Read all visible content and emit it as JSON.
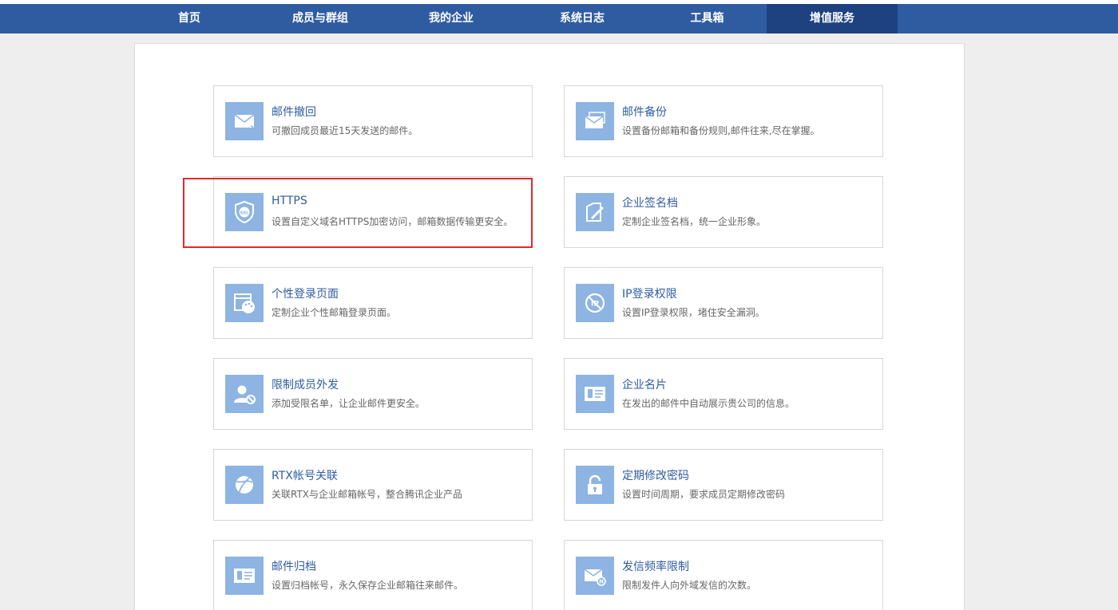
{
  "nav": {
    "items": [
      {
        "label": "首页",
        "width": 164
      },
      {
        "label": "成员与群组",
        "width": 164
      },
      {
        "label": "我的企业",
        "width": 164
      },
      {
        "label": "系统日志",
        "width": 164
      },
      {
        "label": "工具箱",
        "width": 149
      },
      {
        "label": "增值服务",
        "width": 164
      }
    ],
    "active": "增值服务"
  },
  "services": [
    {
      "title": "邮件撤回",
      "desc": "可撤回成员最近15天发送的邮件。",
      "icon": "mail-recall-icon"
    },
    {
      "title": "邮件备份",
      "desc": "设置备份邮箱和备份规则,邮件往来,尽在掌握。",
      "icon": "mail-backup-icon"
    },
    {
      "title": "HTTPS",
      "desc": "设置自定义域名HTTPS加密访问，邮箱数据传输更安全。",
      "icon": "ssl-shield-icon"
    },
    {
      "title": "企业签名档",
      "desc": "定制企业签名档，统一企业形象。",
      "icon": "signature-pen-icon"
    },
    {
      "title": "个性登录页面",
      "desc": "定制企业个性邮箱登录页面。",
      "icon": "palette-window-icon"
    },
    {
      "title": "IP登录权限",
      "desc": "设置IP登录权限，堵住安全漏洞。",
      "icon": "ip-block-icon"
    },
    {
      "title": "限制成员外发",
      "desc": "添加受限名单，让企业邮件更安全。",
      "icon": "user-block-icon"
    },
    {
      "title": "企业名片",
      "desc": "在发出的邮件中自动展示贵公司的信息。",
      "icon": "business-card-icon"
    },
    {
      "title": "RTX帐号关联",
      "desc": "关联RTX与企业邮箱帐号，整合腾讯企业产品",
      "icon": "rtx-ball-icon"
    },
    {
      "title": "定期修改密码",
      "desc": "设置时间周期，要求成员定期修改密码",
      "icon": "padlock-icon"
    },
    {
      "title": "邮件归档",
      "desc": "设置归档帐号，永久保存企业邮箱往来邮件。",
      "icon": "archive-card-icon"
    },
    {
      "title": "发信频率限制",
      "desc": "限制发件人向外域发信的次数。",
      "icon": "mail-limit-icon"
    }
  ]
}
